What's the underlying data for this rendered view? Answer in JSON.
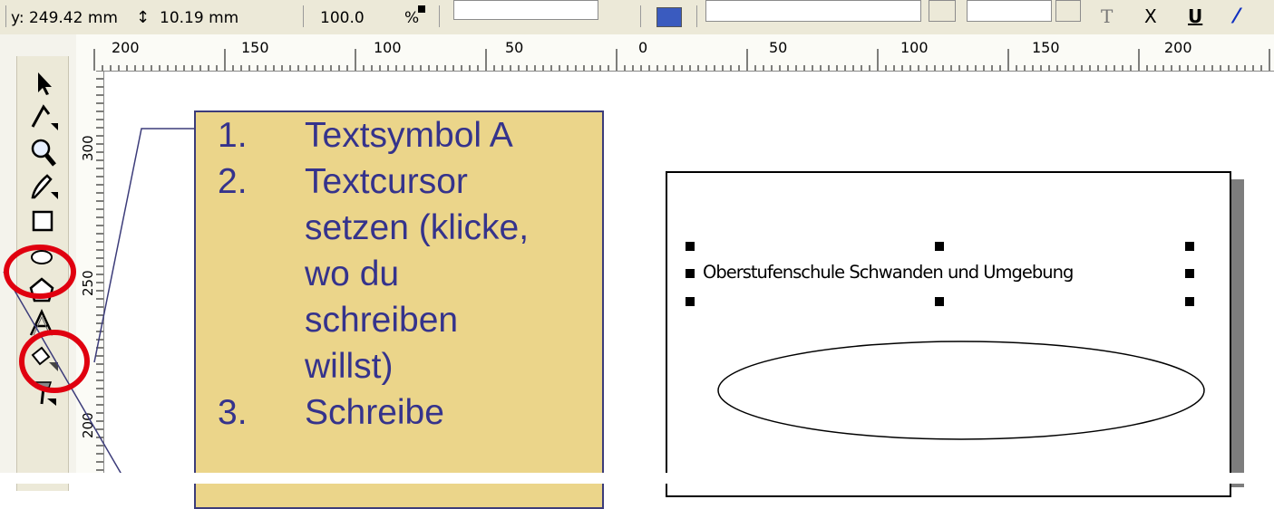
{
  "property_bar": {
    "y_label": "y: 249.42 mm",
    "height_value": "10.19 mm",
    "scale_value": "100.0",
    "percent_label": "%",
    "icons": [
      "height-arrows-icon",
      "lock-icon",
      "rotate-icon",
      "align-icon",
      "font-icon",
      "bold-icon",
      "italic-icon",
      "underline-icon",
      "horizontal-text-icon"
    ],
    "bold_label": "X",
    "underline_label": "U"
  },
  "horizontal_ruler": {
    "labels": [
      "200",
      "150",
      "100",
      "50",
      "0",
      "50",
      "100",
      "150",
      "200"
    ]
  },
  "vertical_ruler": {
    "labels": [
      "300",
      "250",
      "200"
    ]
  },
  "toolbox": {
    "tools": [
      {
        "name": "pick-tool",
        "icon": "arrow-pointer-icon"
      },
      {
        "name": "shape-tool",
        "icon": "shape-edit-icon"
      },
      {
        "name": "zoom-tool",
        "icon": "magnifier-icon"
      },
      {
        "name": "freehand-tool",
        "icon": "pencil-icon"
      },
      {
        "name": "rectangle-tool",
        "icon": "rectangle-icon"
      },
      {
        "name": "ellipse-tool",
        "icon": "ellipse-icon"
      },
      {
        "name": "polygon-tool",
        "icon": "polygon-icon"
      },
      {
        "name": "text-tool",
        "icon": "text-a-icon"
      },
      {
        "name": "fill-tool",
        "icon": "paint-bucket-icon"
      },
      {
        "name": "interactive-tool",
        "icon": "eyedropper-icon"
      }
    ],
    "highlight_color": "#e0000f"
  },
  "callout": {
    "items": [
      {
        "number": "1.",
        "lines": [
          "Textsymbol A"
        ]
      },
      {
        "number": "2.",
        "lines": [
          "Textcursor",
          "setzen (klicke,",
          "wo du",
          "schreiben",
          "willst)"
        ]
      },
      {
        "number": "3.",
        "lines": [
          "Schreibe"
        ]
      }
    ],
    "background_color": "#ebd58a",
    "text_color": "#35338c"
  },
  "document": {
    "text": "Oberstufenschule Schwanden und Umgebung"
  }
}
